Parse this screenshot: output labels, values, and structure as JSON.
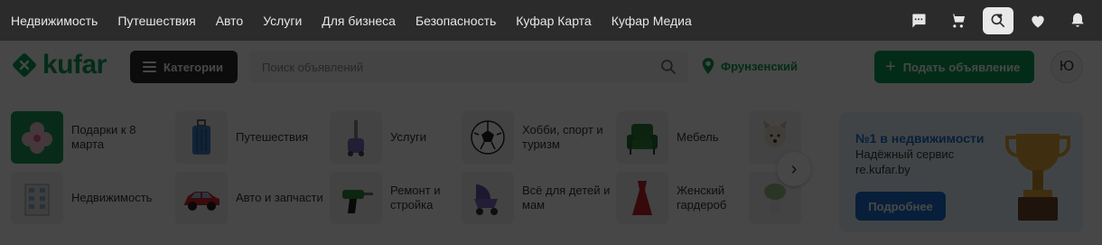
{
  "topnav": {
    "links": [
      "Недвижимость",
      "Путешествия",
      "Авто",
      "Услуги",
      "Для бизнеса",
      "Безопасность",
      "Куфар Карта",
      "Куфар Медиа"
    ],
    "icons": [
      "chat-icon",
      "cart-icon",
      "search-heart-icon",
      "heart-icon",
      "bell-icon"
    ]
  },
  "header": {
    "logo": "kufar",
    "categories_label": "Категории",
    "search_placeholder": "Поиск объявлений",
    "location": "Фрунзенский",
    "post_label": "Подать объявление",
    "avatar_letter": "Ю"
  },
  "categories": [
    {
      "label": "Подарки к 8 марта",
      "icon": "gift-flower"
    },
    {
      "label": "Путешествия",
      "icon": "suitcase"
    },
    {
      "label": "Услуги",
      "icon": "vacuum"
    },
    {
      "label": "Хобби, спорт и туризм",
      "icon": "football"
    },
    {
      "label": "Мебель",
      "icon": "armchair"
    },
    {
      "label": "",
      "icon": "dog"
    },
    {
      "label": "Недвижимость",
      "icon": "building"
    },
    {
      "label": "Авто и запчасти",
      "icon": "car"
    },
    {
      "label": "Ремонт и стройка",
      "icon": "drill"
    },
    {
      "label": "Всё для детей и мам",
      "icon": "stroller"
    },
    {
      "label": "Женский гардероб",
      "icon": "dress"
    },
    {
      "label": "",
      "icon": "plant"
    }
  ],
  "promo": {
    "title": "№1 в недвижимости",
    "line1": "Надёжный сервис",
    "line2": "re.kufar.by",
    "button": "Подробнее"
  },
  "colors": {
    "brand": "#0a9d58",
    "topbar": "#2b2b2b",
    "promo_accent": "#1a6fd1"
  }
}
